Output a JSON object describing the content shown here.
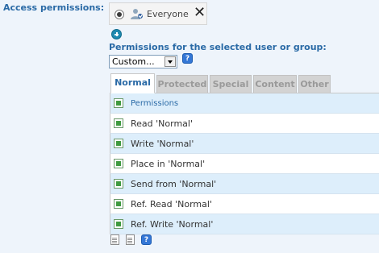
{
  "access": {
    "label": "Access permissions:",
    "principal": {
      "name": "Everyone",
      "icon": "user-group-icon",
      "remove": "✕"
    },
    "add_icon": "add-icon"
  },
  "permissions": {
    "heading": "Permissions for the selected user or group:",
    "select_value": "Custom...",
    "help_glyph": "?"
  },
  "tabs": [
    {
      "label": "Normal",
      "active": true
    },
    {
      "label": "Protected",
      "active": false
    },
    {
      "label": "Special",
      "active": false
    },
    {
      "label": "Content",
      "active": false
    },
    {
      "label": "Other",
      "active": false
    }
  ],
  "table": {
    "header": "Permissions",
    "rows": [
      {
        "label": "Read 'Normal'",
        "checked": true
      },
      {
        "label": "Write 'Normal'",
        "checked": true
      },
      {
        "label": "Place in 'Normal'",
        "checked": true
      },
      {
        "label": "Send from 'Normal'",
        "checked": true
      },
      {
        "label": "Ref. Read 'Normal'",
        "checked": true
      },
      {
        "label": "Ref. Write 'Normal'",
        "checked": true
      }
    ]
  },
  "colors": {
    "heading": "#2a6aa6",
    "row_alt": "#ddeefb",
    "check_fill": "#3f9a3f"
  },
  "bottom_tools": [
    "copy-icon",
    "paste-icon",
    "help-icon"
  ]
}
